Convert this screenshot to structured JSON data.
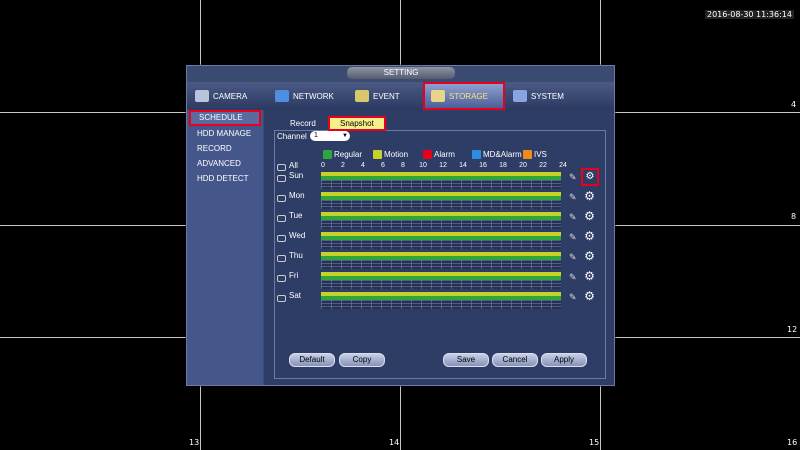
{
  "timestamp": "2016-08-30 11:36:14",
  "channel_numbers": [
    "4",
    "8",
    "12",
    "13",
    "14",
    "15",
    "16"
  ],
  "dialog": {
    "title": "SETTING",
    "top_tabs": [
      {
        "label": "CAMERA",
        "icon": "camera-icon"
      },
      {
        "label": "NETWORK",
        "icon": "network-icon"
      },
      {
        "label": "EVENT",
        "icon": "event-icon"
      },
      {
        "label": "STORAGE",
        "icon": "storage-icon",
        "active": true
      },
      {
        "label": "SYSTEM",
        "icon": "system-icon"
      }
    ],
    "sidebar": [
      {
        "label": "SCHEDULE",
        "active": true
      },
      {
        "label": "HDD MANAGE"
      },
      {
        "label": "RECORD"
      },
      {
        "label": "ADVANCED"
      },
      {
        "label": "HDD DETECT"
      }
    ],
    "sub_tabs": [
      {
        "label": "Record"
      },
      {
        "label": "Snapshot",
        "active": true
      }
    ],
    "channel": {
      "label": "Channel",
      "value": "1"
    },
    "legend": [
      {
        "label": "Regular",
        "color": "#2ea63b"
      },
      {
        "label": "Motion",
        "color": "#c7d12a"
      },
      {
        "label": "Alarm",
        "color": "#e8001c"
      },
      {
        "label": "MD&Alarm",
        "color": "#2f8de0"
      },
      {
        "label": "IVS",
        "color": "#f08a1a"
      }
    ],
    "all_label": "All",
    "hours": [
      "0",
      "2",
      "4",
      "6",
      "8",
      "10",
      "12",
      "14",
      "16",
      "18",
      "20",
      "22",
      "24"
    ],
    "days": [
      "Sun",
      "Mon",
      "Tue",
      "Wed",
      "Thu",
      "Fri",
      "Sat"
    ],
    "buttons": {
      "default": "Default",
      "copy": "Copy",
      "save": "Save",
      "cancel": "Cancel",
      "apply": "Apply"
    }
  }
}
